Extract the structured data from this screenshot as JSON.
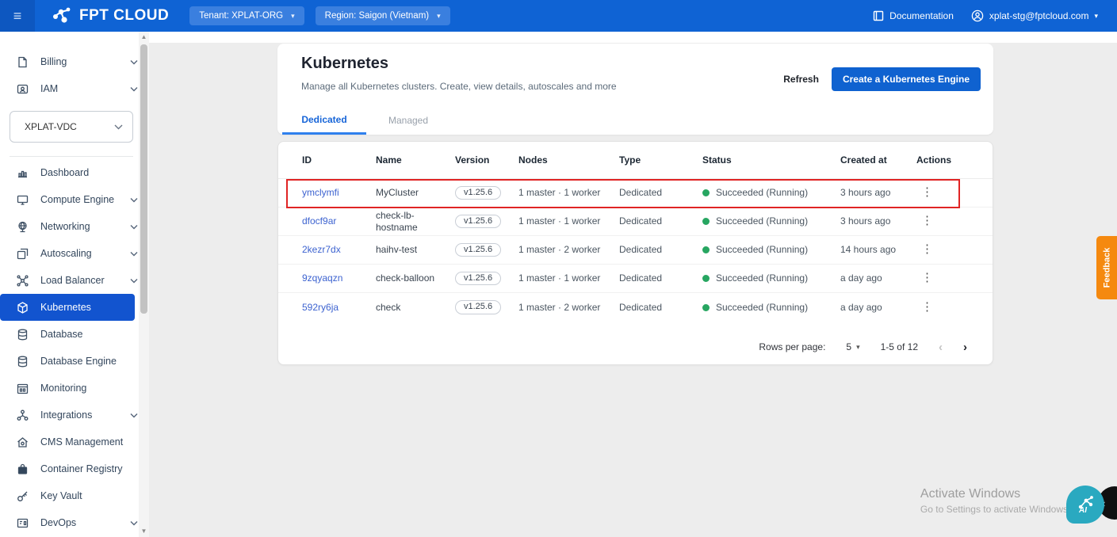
{
  "topbar": {
    "brand": "FPT CLOUD",
    "tenant_label": "Tenant: XPLAT-ORG",
    "region_label": "Region: Saigon (Vietnam)",
    "documentation_label": "Documentation",
    "user_email": "xplat-stg@fptcloud.com"
  },
  "sidebar": {
    "top_items": [
      {
        "label": "Billing"
      },
      {
        "label": "IAM"
      }
    ],
    "vdc_selector": "XPLAT-VDC",
    "items": [
      {
        "label": "Dashboard"
      },
      {
        "label": "Compute Engine"
      },
      {
        "label": "Networking"
      },
      {
        "label": "Autoscaling"
      },
      {
        "label": "Load Balancer"
      },
      {
        "label": "Kubernetes"
      },
      {
        "label": "Database"
      },
      {
        "label": "Database Engine"
      },
      {
        "label": "Monitoring"
      },
      {
        "label": "Integrations"
      },
      {
        "label": "CMS Management"
      },
      {
        "label": "Container Registry"
      },
      {
        "label": "Key Vault"
      },
      {
        "label": "DevOps"
      }
    ]
  },
  "page": {
    "title": "Kubernetes",
    "subtitle": "Manage all Kubernetes clusters. Create, view details, autoscales and more",
    "refresh_label": "Refresh",
    "create_label": "Create a Kubernetes Engine",
    "tabs": {
      "dedicated": "Dedicated",
      "managed": "Managed"
    }
  },
  "table": {
    "columns": [
      "ID",
      "Name",
      "Version",
      "Nodes",
      "Type",
      "Status",
      "Created at",
      "Actions"
    ],
    "rows": [
      {
        "id": "ymclymfi",
        "name": "MyCluster",
        "version": "v1.25.6",
        "nodes": "1 master · 1 worker",
        "type": "Dedicated",
        "status": "Succeeded (Running)",
        "created": "3 hours ago"
      },
      {
        "id": "dfocf9ar",
        "name": "check-lb-hostname",
        "version": "v1.25.6",
        "nodes": "1 master · 1 worker",
        "type": "Dedicated",
        "status": "Succeeded (Running)",
        "created": "3 hours ago"
      },
      {
        "id": "2kezr7dx",
        "name": "haihv-test",
        "version": "v1.25.6",
        "nodes": "1 master · 2 worker",
        "type": "Dedicated",
        "status": "Succeeded (Running)",
        "created": "14 hours ago"
      },
      {
        "id": "9zqyaqzn",
        "name": "check-balloon",
        "version": "v1.25.6",
        "nodes": "1 master · 1 worker",
        "type": "Dedicated",
        "status": "Succeeded (Running)",
        "created": "a day ago"
      },
      {
        "id": "592ry6ja",
        "name": "check",
        "version": "v1.25.6",
        "nodes": "1 master · 2 worker",
        "type": "Dedicated",
        "status": "Succeeded (Running)",
        "created": "a day ago"
      }
    ],
    "pagination": {
      "rows_per_page_label": "Rows per page:",
      "rows_per_page": "5",
      "range": "1-5 of 12"
    }
  },
  "overlays": {
    "feedback_label": "Feedback",
    "activate_title": "Activate Windows",
    "activate_subtitle": "Go to Settings to activate Windows"
  },
  "icons": {
    "hamburger": "≡",
    "chevron_down": "▾",
    "kebab": "⋮",
    "page_prev": "‹",
    "page_next": "›",
    "scroll_up": "▲",
    "scroll_down": "▼",
    "edge_chevron": "‹"
  },
  "colors": {
    "topbar_blue": "#0f63d4",
    "primary_blue": "#0f62d0",
    "sidebar_active_blue": "#1254cf",
    "status_green": "#27a661",
    "highlight_red": "#e02424",
    "feedback_orange": "#f5890f",
    "ai_bubble_teal": "#2aa9c0"
  }
}
